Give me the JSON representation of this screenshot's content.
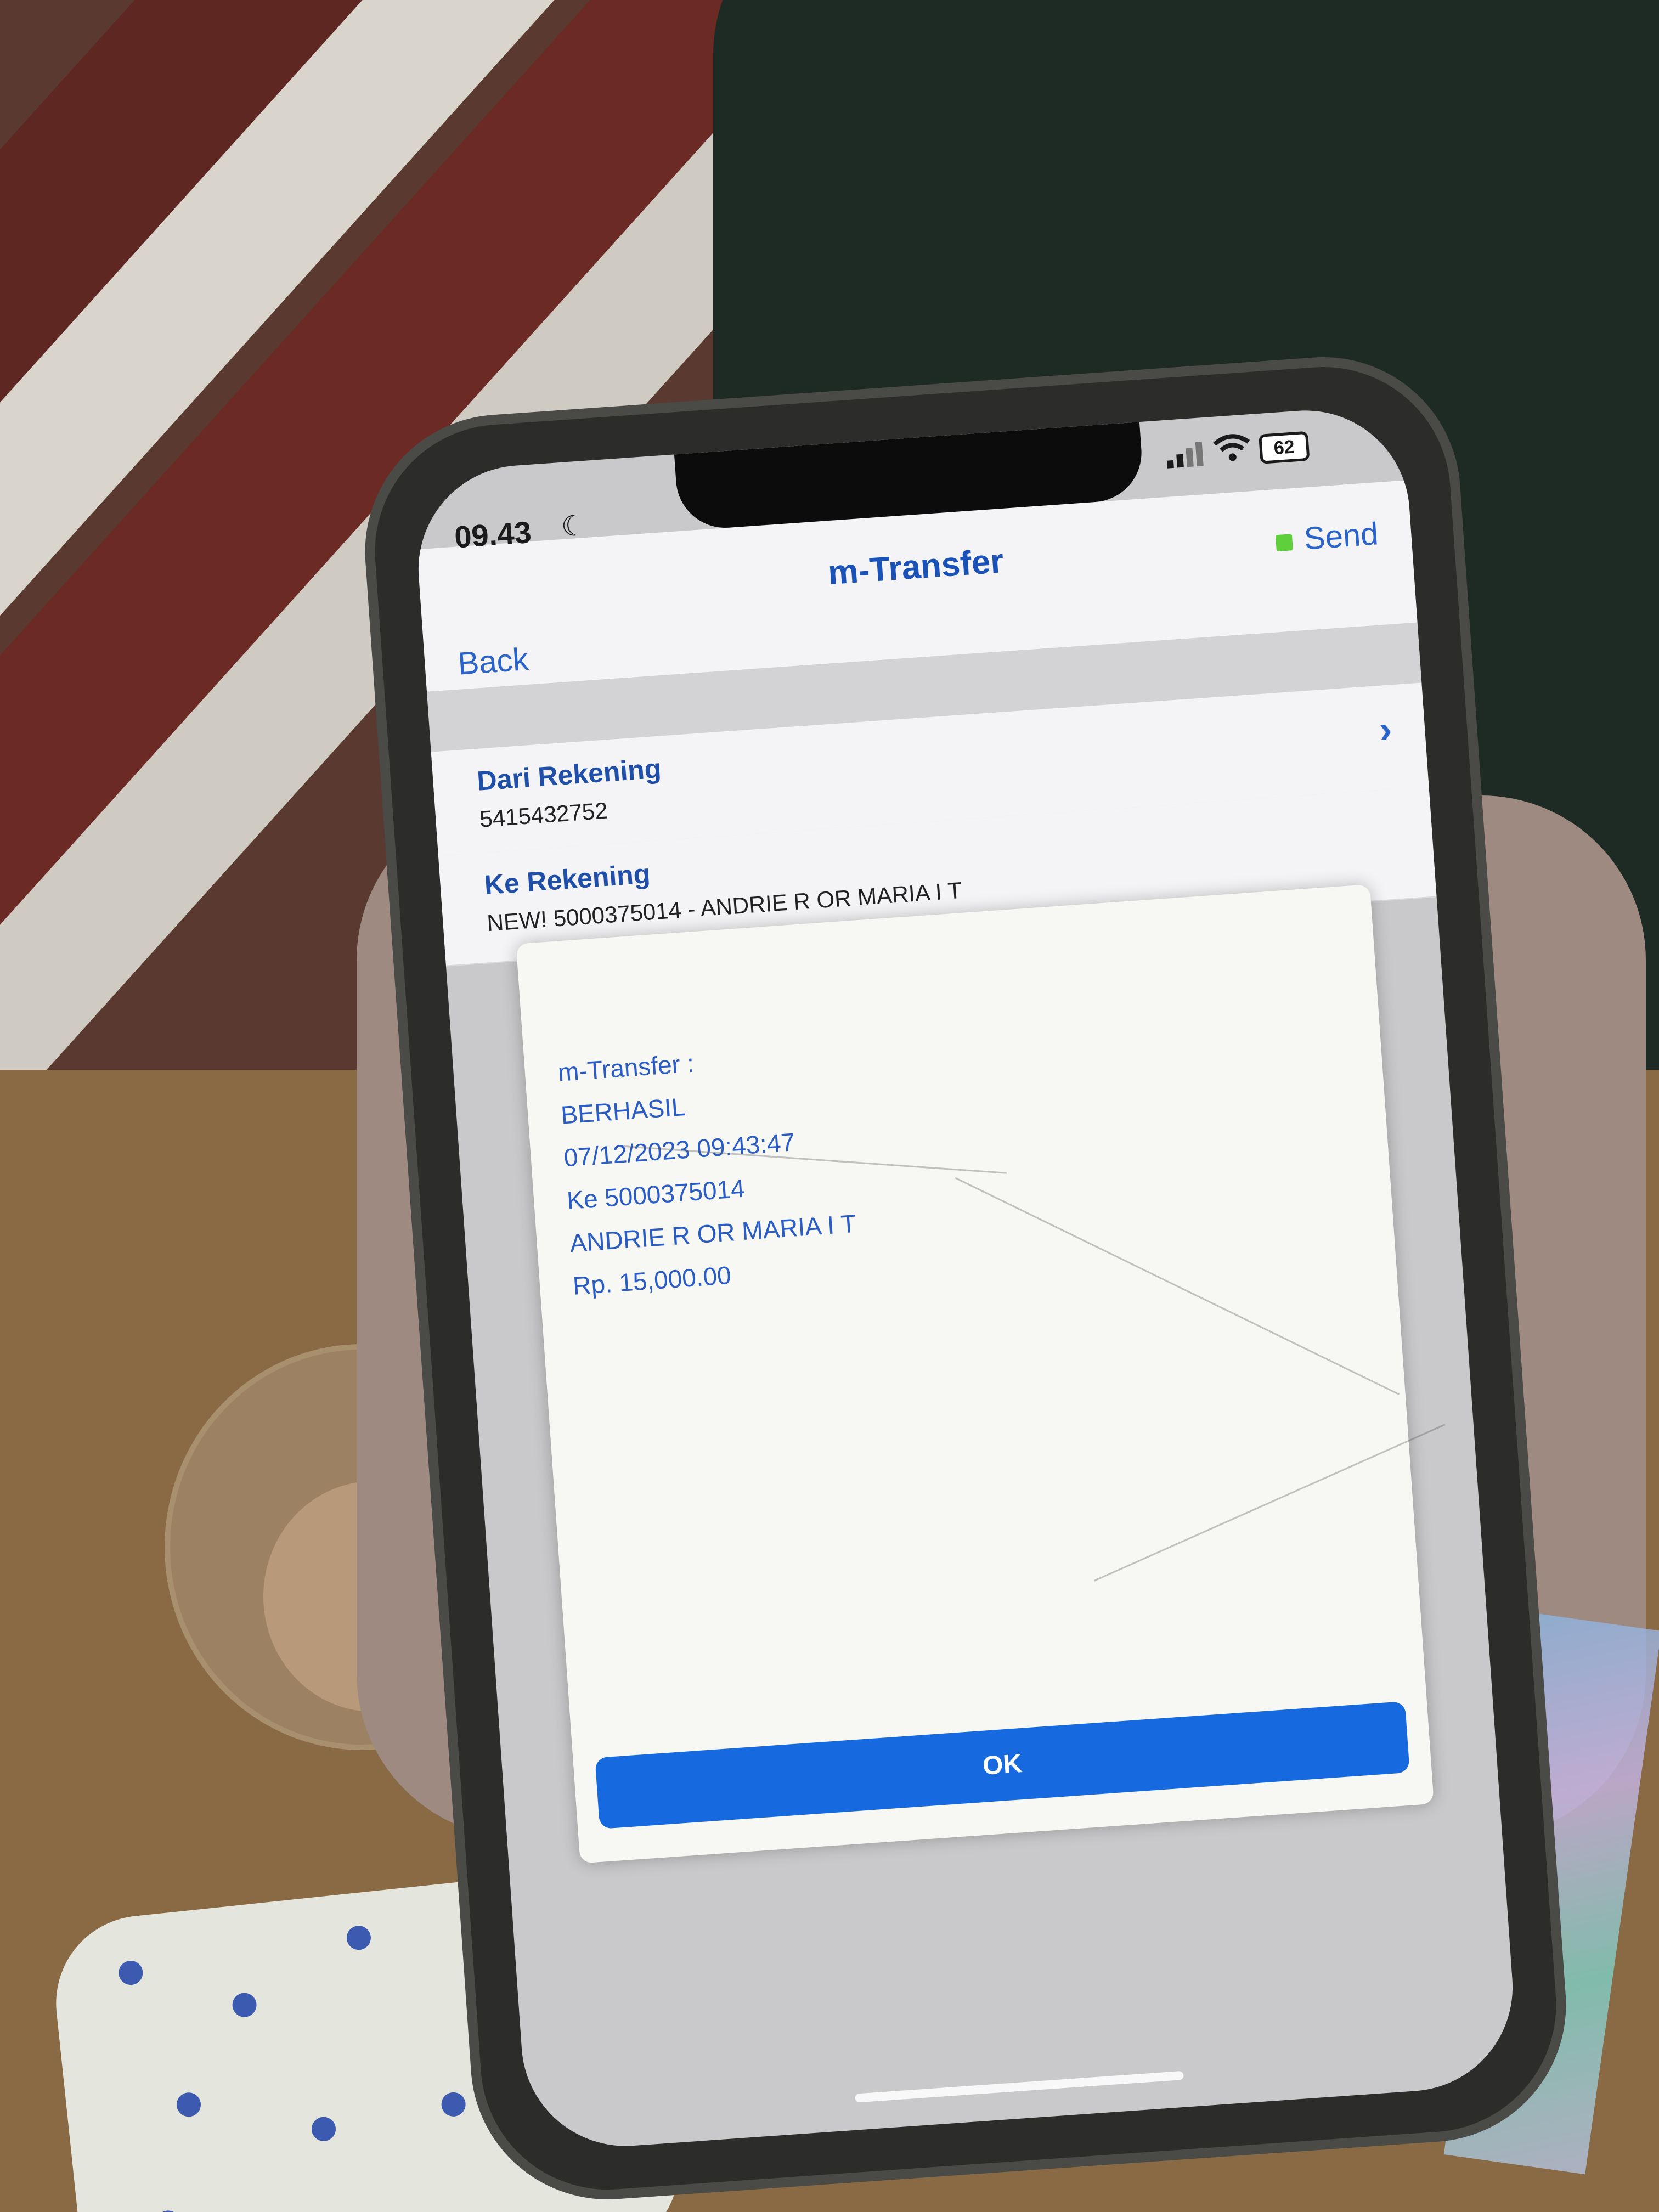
{
  "status_bar": {
    "time": "09.43",
    "battery": "62"
  },
  "navbar": {
    "title": "m-Transfer",
    "back_label": "Back",
    "send_label": "Send"
  },
  "from_account": {
    "label": "Dari Rekening",
    "value": "5415432752"
  },
  "to_account": {
    "label": "Ke Rekening",
    "value": "NEW! 5000375014 - ANDRIE R OR MARIA I T"
  },
  "dialog": {
    "lines": [
      "m-Transfer :",
      "BERHASIL",
      "07/12/2023 09:43:47",
      "Ke 5000375014",
      "ANDRIE R OR MARIA I T",
      "Rp. 15,000.00"
    ],
    "ok_label": "OK"
  },
  "colors": {
    "accent": "#1769e0",
    "link": "#2a63c9",
    "title": "#1a52b8"
  }
}
